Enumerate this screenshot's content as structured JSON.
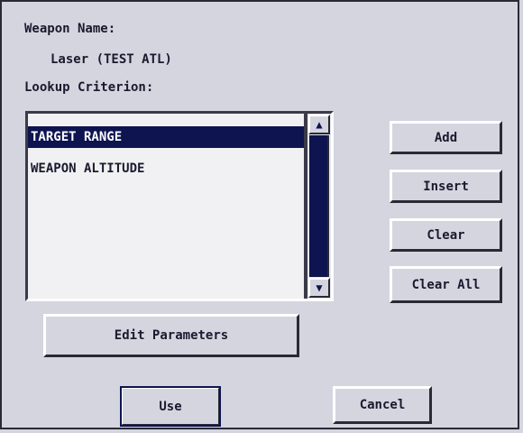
{
  "dialog": {
    "weapon_name_label": "Weapon Name:",
    "weapon_name_value": "Laser (TEST ATL)",
    "lookup_label": "Lookup Criterion:"
  },
  "criteria": {
    "items": [
      {
        "label": "TARGET RANGE",
        "selected": true
      },
      {
        "label": "WEAPON ALTITUDE",
        "selected": false
      }
    ]
  },
  "buttons": {
    "add": "Add",
    "insert": "Insert",
    "clear": "Clear",
    "clear_all": "Clear All",
    "edit_parameters": "Edit Parameters",
    "use": "Use",
    "cancel": "Cancel"
  },
  "icons": {
    "scroll_up": "triangle-up",
    "scroll_down": "triangle-down"
  },
  "colors": {
    "background": "#d5d5e0",
    "selection": "#0d1450",
    "list_background": "#f1f1f3"
  }
}
